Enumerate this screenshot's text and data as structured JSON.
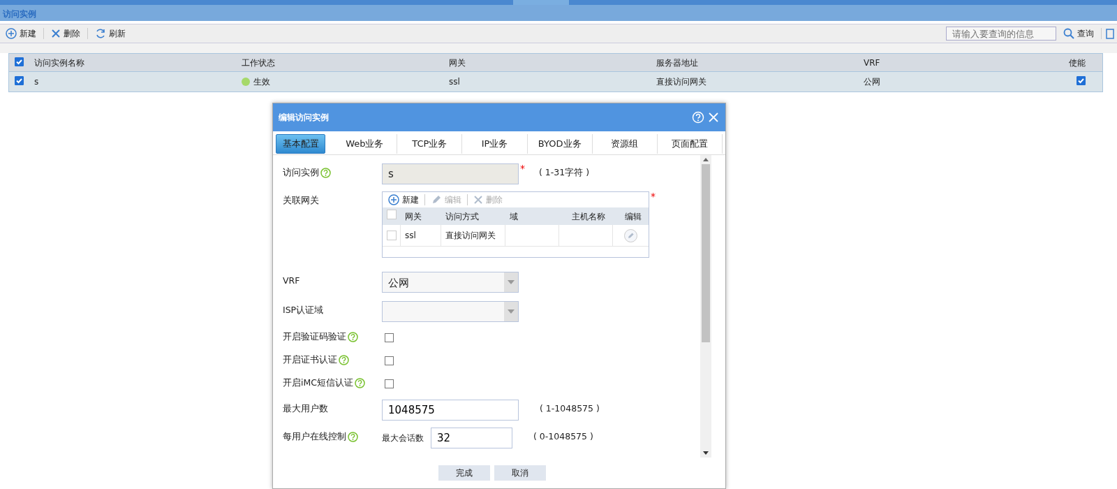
{
  "page": {
    "title": "访问实例"
  },
  "toolbar": {
    "buttons": [
      {
        "kind": "add",
        "label": "新建"
      },
      {
        "kind": "delete",
        "label": "删除"
      },
      {
        "kind": "refresh",
        "label": "刷新"
      }
    ],
    "search": {
      "placeholder": "请输入要查询的信息"
    },
    "query": "查询"
  },
  "table": {
    "all_checked": true,
    "columns": [
      "访问实例名称",
      "工作状态",
      "网关",
      "服务器地址",
      "VRF",
      "使能"
    ],
    "rows": [
      {
        "checked": true,
        "name": "s",
        "status": "生效",
        "color": "#a6d96a",
        "gateway": "ssl",
        "server": "直接访问网关",
        "vrf": "公网",
        "enabled": true
      }
    ]
  },
  "dialog": {
    "title": "编辑访问实例",
    "tabs": [
      {
        "label": "基本配置",
        "selected": true
      },
      {
        "label": "Web业务",
        "selected": false
      },
      {
        "label": "TCP业务",
        "selected": false
      },
      {
        "label": "IP业务",
        "selected": false
      },
      {
        "label": "BYOD业务",
        "selected": false
      },
      {
        "label": "资源组",
        "selected": false
      },
      {
        "label": "页面配置",
        "selected": false
      }
    ],
    "fields": [
      {
        "kind": "text",
        "label": "访问实例",
        "help": true,
        "value": "s",
        "disabled": true,
        "required_mark": "*",
        "hint": "( 1-31字符 )"
      },
      {
        "kind": "grid",
        "label": "关联网关",
        "required_mark": "*",
        "actions": [
          {
            "kind": "add",
            "label": "新建",
            "disabled": false
          },
          {
            "kind": "edit",
            "label": "编辑",
            "disabled": true
          },
          {
            "kind": "delete",
            "label": "删除",
            "disabled": true
          }
        ],
        "columns": [
          "网关",
          "访问方式",
          "域",
          "主机名称",
          "编辑"
        ],
        "all_checked": false,
        "rows": [
          {
            "checked": false,
            "gateway": "ssl",
            "access": "直接访问网关"
          }
        ]
      },
      {
        "kind": "select",
        "label": "VRF",
        "value": "公网"
      },
      {
        "kind": "select",
        "label": "ISP认证域"
      },
      {
        "kind": "checkbox",
        "label": "开启验证码验证",
        "help": true,
        "checked": false
      },
      {
        "kind": "checkbox",
        "label": "开启证书认证",
        "help": true,
        "checked": false
      },
      {
        "kind": "checkbox",
        "label": "开启iMC短信认证",
        "help": true,
        "checked": false
      },
      {
        "kind": "text",
        "label": "最大用户数",
        "value": "1048575",
        "disabled": false,
        "hint": "( 1-1048575 )"
      },
      {
        "kind": "sub",
        "label": "每用户在线控制",
        "help": true,
        "sublabel": "最大会话数",
        "value": "32",
        "hint": "( 0-1048575 )"
      }
    ],
    "buttons": [
      "完成",
      "取消"
    ]
  }
}
